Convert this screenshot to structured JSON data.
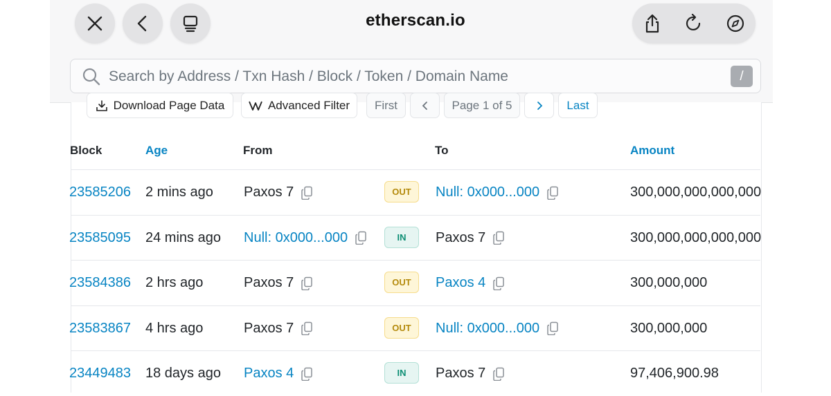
{
  "browser": {
    "domain": "etherscan.io",
    "buttons": {
      "close": "close-icon",
      "back": "chevron-left-icon",
      "tabs": "tab-overview-icon",
      "share": "share-icon",
      "reload": "reload-icon",
      "compass": "compass-icon"
    }
  },
  "search": {
    "placeholder": "Search by Address / Txn Hash / Block / Token / Domain Name",
    "shortcut": "/"
  },
  "toolbar": {
    "download_label": "Download Page Data",
    "filter_label": "Advanced Filter",
    "first_label": "First",
    "page_label": "Page 1 of 5",
    "last_label": "Last"
  },
  "table": {
    "headers": {
      "block": "Block",
      "age": "Age",
      "from": "From",
      "to": "To",
      "amount": "Amount"
    },
    "rows": [
      {
        "block": "23585206",
        "age": "2 mins ago",
        "from": "Paxos 7",
        "direction": "OUT",
        "to": "Null: 0x000...000",
        "amount": "300,000,000,000,000"
      },
      {
        "block": "23585095",
        "age": "24 mins ago",
        "from": "Null: 0x000...000",
        "direction": "IN",
        "to": "Paxos 7",
        "amount": "300,000,000,000,000"
      },
      {
        "block": "23584386",
        "age": "2 hrs ago",
        "from": "Paxos 7",
        "direction": "OUT",
        "to": "Paxos 4",
        "amount": "300,000,000"
      },
      {
        "block": "23583867",
        "age": "4 hrs ago",
        "from": "Paxos 7",
        "direction": "OUT",
        "to": "Null: 0x000...000",
        "amount": "300,000,000"
      },
      {
        "block": "23449483",
        "age": "18 days ago",
        "from": "Paxos 4",
        "direction": "IN",
        "to": "Paxos 7",
        "amount": "97,406,900.98"
      }
    ]
  },
  "colors": {
    "link": "#0784c3",
    "out_badge": "#fef6d8",
    "in_badge": "#e6f5f2"
  }
}
